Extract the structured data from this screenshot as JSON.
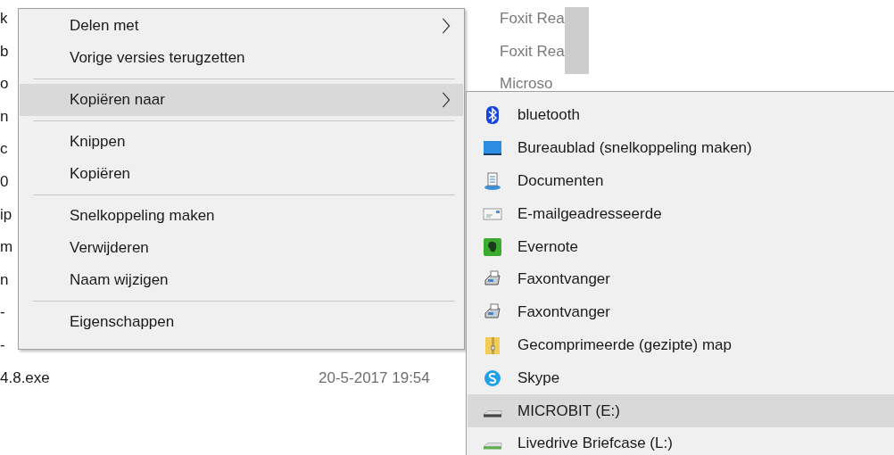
{
  "files": [
    {
      "name": "k",
      "type": "Foxit Rea"
    },
    {
      "name": "b",
      "type": "Foxit Rea"
    },
    {
      "name": "o",
      "type": "Microso"
    },
    {
      "name": "n"
    },
    {
      "name": "c"
    },
    {
      "name": "0"
    },
    {
      "name": "ip"
    },
    {
      "name": "m"
    },
    {
      "name": "n"
    },
    {
      "name": "-"
    },
    {
      "name": "-"
    },
    {
      "name": "4.8.exe",
      "date": "20-5-2017 19:54"
    }
  ],
  "context_menu": [
    {
      "kind": "item",
      "label": "Delen met",
      "submenu": true,
      "selected": false
    },
    {
      "kind": "item",
      "label": "Vorige versies terugzetten",
      "submenu": false,
      "selected": false
    },
    {
      "kind": "separator"
    },
    {
      "kind": "item",
      "label": "Kopiëren naar",
      "submenu": true,
      "selected": true
    },
    {
      "kind": "separator"
    },
    {
      "kind": "item",
      "label": "Knippen",
      "submenu": false,
      "selected": false
    },
    {
      "kind": "item",
      "label": "Kopiëren",
      "submenu": false,
      "selected": false
    },
    {
      "kind": "separator"
    },
    {
      "kind": "item",
      "label": "Snelkoppeling maken",
      "submenu": false,
      "selected": false
    },
    {
      "kind": "item",
      "label": "Verwijderen",
      "submenu": false,
      "selected": false
    },
    {
      "kind": "item",
      "label": "Naam wijzigen",
      "submenu": false,
      "selected": false
    },
    {
      "kind": "separator"
    },
    {
      "kind": "item",
      "label": "Eigenschappen",
      "submenu": false,
      "selected": false
    }
  ],
  "submenu": [
    {
      "kind": "bluetooth",
      "label": "bluetooth",
      "selected": false
    },
    {
      "kind": "desktop",
      "label": "Bureaublad (snelkoppeling maken)",
      "selected": false
    },
    {
      "kind": "documents",
      "label": "Documenten",
      "selected": false
    },
    {
      "kind": "mail",
      "label": "E-mailgeadresseerde",
      "selected": false
    },
    {
      "kind": "evernote",
      "label": "Evernote",
      "selected": false
    },
    {
      "kind": "fax",
      "label": "Faxontvanger",
      "selected": false
    },
    {
      "kind": "fax",
      "label": "Faxontvanger",
      "selected": false
    },
    {
      "kind": "zip",
      "label": "Gecomprimeerde (gezipte) map",
      "selected": false
    },
    {
      "kind": "skype",
      "label": "Skype",
      "selected": false
    },
    {
      "kind": "drive",
      "label": "MICROBIT (E:)",
      "selected": true
    },
    {
      "kind": "drive-green",
      "label": "Livedrive Briefcase (L:)",
      "selected": false
    }
  ]
}
